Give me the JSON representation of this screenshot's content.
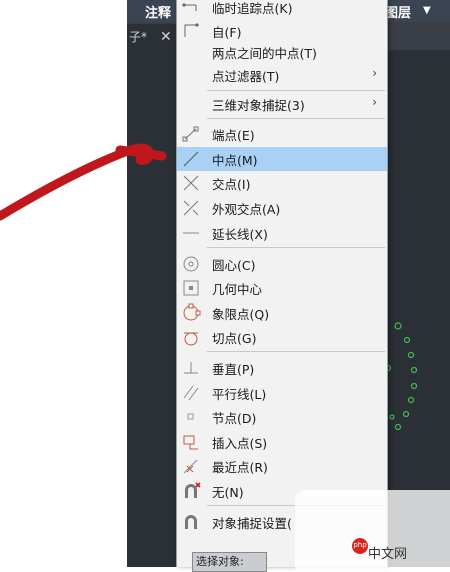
{
  "ribbon": {
    "tab_left": "注释",
    "tab_right": "图层"
  },
  "document_tab": {
    "title": "子*",
    "close": "✕"
  },
  "command_line": {
    "prompt": "选择对象:"
  },
  "watermark": {
    "brand": "php",
    "site": "中文网"
  },
  "colors": {
    "highlight": "#a9d1f5",
    "cad_background": "#2b2f36",
    "annotation_red": "#c0171c"
  },
  "menu": {
    "items": [
      {
        "label": "临时追踪点(K)",
        "icon": "tracking-point-icon"
      },
      {
        "label": "自(F)",
        "icon": "from-icon"
      },
      {
        "label": "两点之间的中点(T)",
        "icon": ""
      },
      {
        "label": "点过滤器(T)",
        "icon": "",
        "submenu": true
      },
      {
        "label": "三维对象捕捉(3)",
        "icon": "",
        "submenu": true
      },
      {
        "label": "端点(E)",
        "icon": "endpoint-icon"
      },
      {
        "label": "中点(M)",
        "icon": "midpoint-icon",
        "selected": true
      },
      {
        "label": "交点(I)",
        "icon": "intersection-icon"
      },
      {
        "label": "外观交点(A)",
        "icon": "apparent-intersection-icon"
      },
      {
        "label": "延长线(X)",
        "icon": "extension-icon"
      },
      {
        "label": "圆心(C)",
        "icon": "center-icon"
      },
      {
        "label": "几何中心",
        "icon": "geometric-center-icon"
      },
      {
        "label": "象限点(Q)",
        "icon": "quadrant-icon"
      },
      {
        "label": "切点(G)",
        "icon": "tangent-icon"
      },
      {
        "label": "垂直(P)",
        "icon": "perpendicular-icon"
      },
      {
        "label": "平行线(L)",
        "icon": "parallel-icon"
      },
      {
        "label": "节点(D)",
        "icon": "node-icon"
      },
      {
        "label": "插入点(S)",
        "icon": "insertion-icon"
      },
      {
        "label": "最近点(R)",
        "icon": "nearest-icon"
      },
      {
        "label": "无(N)",
        "icon": "none-icon"
      },
      {
        "label": "对象捕捉设置(",
        "icon": "osnap-settings-icon"
      }
    ]
  }
}
